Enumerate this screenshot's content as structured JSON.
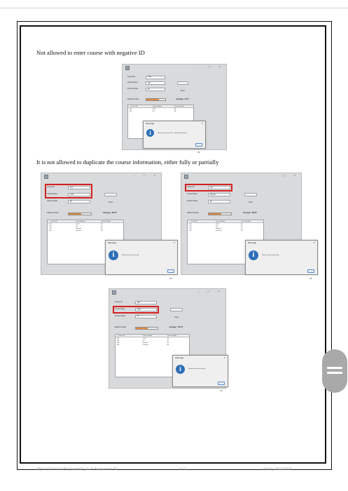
{
  "document": {
    "caption_1": "Not allowed to enter course with negative ID",
    "caption_2": "It is not allowed to duplicate the course information, either fully or partially",
    "footer": {
      "left": "Object-Oriented Programming, Lab-Assessment #2",
      "center": "4 / 5",
      "right": "Spring 2022/2023"
    }
  },
  "window_controls": "-  □  ×",
  "labels": {
    "course_id": "Course ID",
    "course_name": "Course Name",
    "course_grade": "Course Grade",
    "added_courses": "Added Courses",
    "insert_button": "Insert",
    "message_title": "Message",
    "ok_button": "OK",
    "column_headers": [
      "Course ID",
      "Course Name",
      "Course Grade"
    ]
  },
  "info_icon_glyph": "i",
  "screenshots": [
    {
      "course_id": "-101",
      "course_name": "OB",
      "course_grade": "90",
      "average": "Average = 94.5",
      "progress": 0.65,
      "rows": [
        [
          "101",
          "OOP",
          "99"
        ],
        [
          "102",
          "DS",
          "90"
        ]
      ],
      "message": "Please enter course ID : Should be Positive"
    },
    {
      "course_id": "101",
      "course_name": "OOP",
      "course_grade": "95",
      "average": "Average = 86.75",
      "progress": 0.55,
      "rows": [
        [
          "101",
          "OOP",
          "99"
        ],
        [
          "102",
          "DS",
          "90"
        ],
        [
          "103",
          "Network",
          "90"
        ],
        [
          "104",
          "Calculus",
          "68"
        ]
      ],
      "message": "Please check course info"
    },
    {
      "course_id": "101",
      "course_name": "Physics",
      "course_grade": "90",
      "average": "Average = 86.75",
      "progress": 0.55,
      "rows": [
        [
          "101",
          "OOP",
          "99"
        ],
        [
          "102",
          "DS",
          "90"
        ],
        [
          "103",
          "Network",
          "90"
        ],
        [
          "104",
          "Calculus",
          "68"
        ]
      ],
      "message": "Please check course info"
    },
    {
      "course_id": "108",
      "course_name": "OOP",
      "course_grade": "90",
      "average": "Average = 86.75",
      "progress": 0.55,
      "rows": [
        [
          "101",
          "OOP",
          "99"
        ],
        [
          "102",
          "DS",
          "90"
        ],
        [
          "103",
          "Network",
          "90"
        ],
        [
          "104",
          "Calculus",
          "68"
        ]
      ],
      "message": "Please check course info"
    }
  ]
}
